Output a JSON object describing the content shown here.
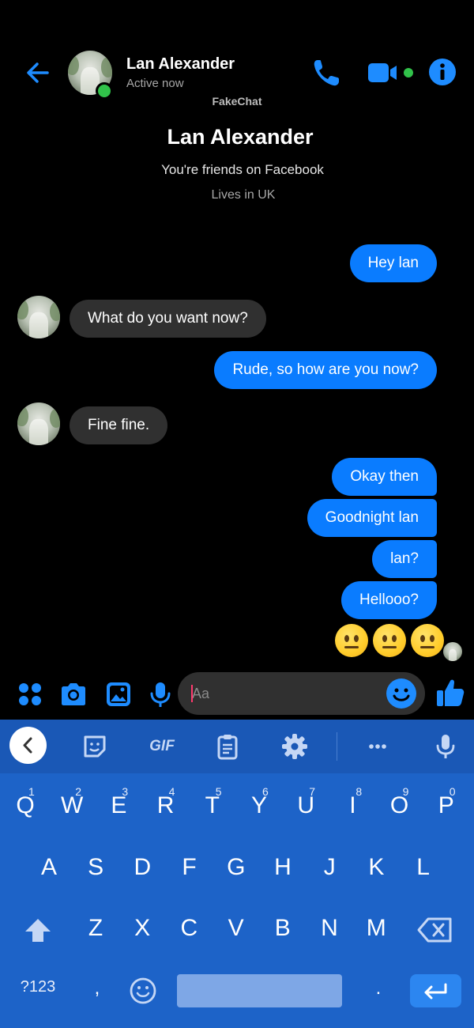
{
  "header": {
    "contact_name": "Lan Alexander",
    "status": "Active now",
    "watermark": "FakeChat"
  },
  "profile": {
    "name": "Lan Alexander",
    "friends_line": "You're friends on Facebook",
    "lives_line": "Lives in UK"
  },
  "messages": [
    {
      "from": "me",
      "text": "Hey lan"
    },
    {
      "from": "them",
      "text": "What do you want now?"
    },
    {
      "from": "me",
      "text": "Rude, so how are you now?"
    },
    {
      "from": "them",
      "text": "Fine fine."
    },
    {
      "from": "me",
      "text": "Okay then"
    },
    {
      "from": "me",
      "text": "Goodnight lan"
    },
    {
      "from": "me",
      "text": "lan?"
    },
    {
      "from": "me",
      "text": "Hellooo?"
    },
    {
      "from": "me",
      "text": "😐😐😐",
      "type": "emoji"
    }
  ],
  "composer": {
    "placeholder": "Aa"
  },
  "keyboard": {
    "toolbar": {
      "gif_label": "GIF"
    },
    "row1": [
      "Q",
      "W",
      "E",
      "R",
      "T",
      "Y",
      "U",
      "I",
      "O",
      "P"
    ],
    "row1_hints": [
      "1",
      "2",
      "3",
      "4",
      "5",
      "6",
      "7",
      "8",
      "9",
      "0"
    ],
    "row2": [
      "A",
      "S",
      "D",
      "F",
      "G",
      "H",
      "J",
      "K",
      "L"
    ],
    "row3": [
      "Z",
      "X",
      "C",
      "V",
      "B",
      "N",
      "M"
    ],
    "symbols_label": "?123",
    "comma": ",",
    "period": "."
  },
  "colors": {
    "accent": "#0a7cff",
    "received_bubble": "#303030",
    "keyboard_bg": "#1d63c8",
    "online": "#31c24a"
  }
}
